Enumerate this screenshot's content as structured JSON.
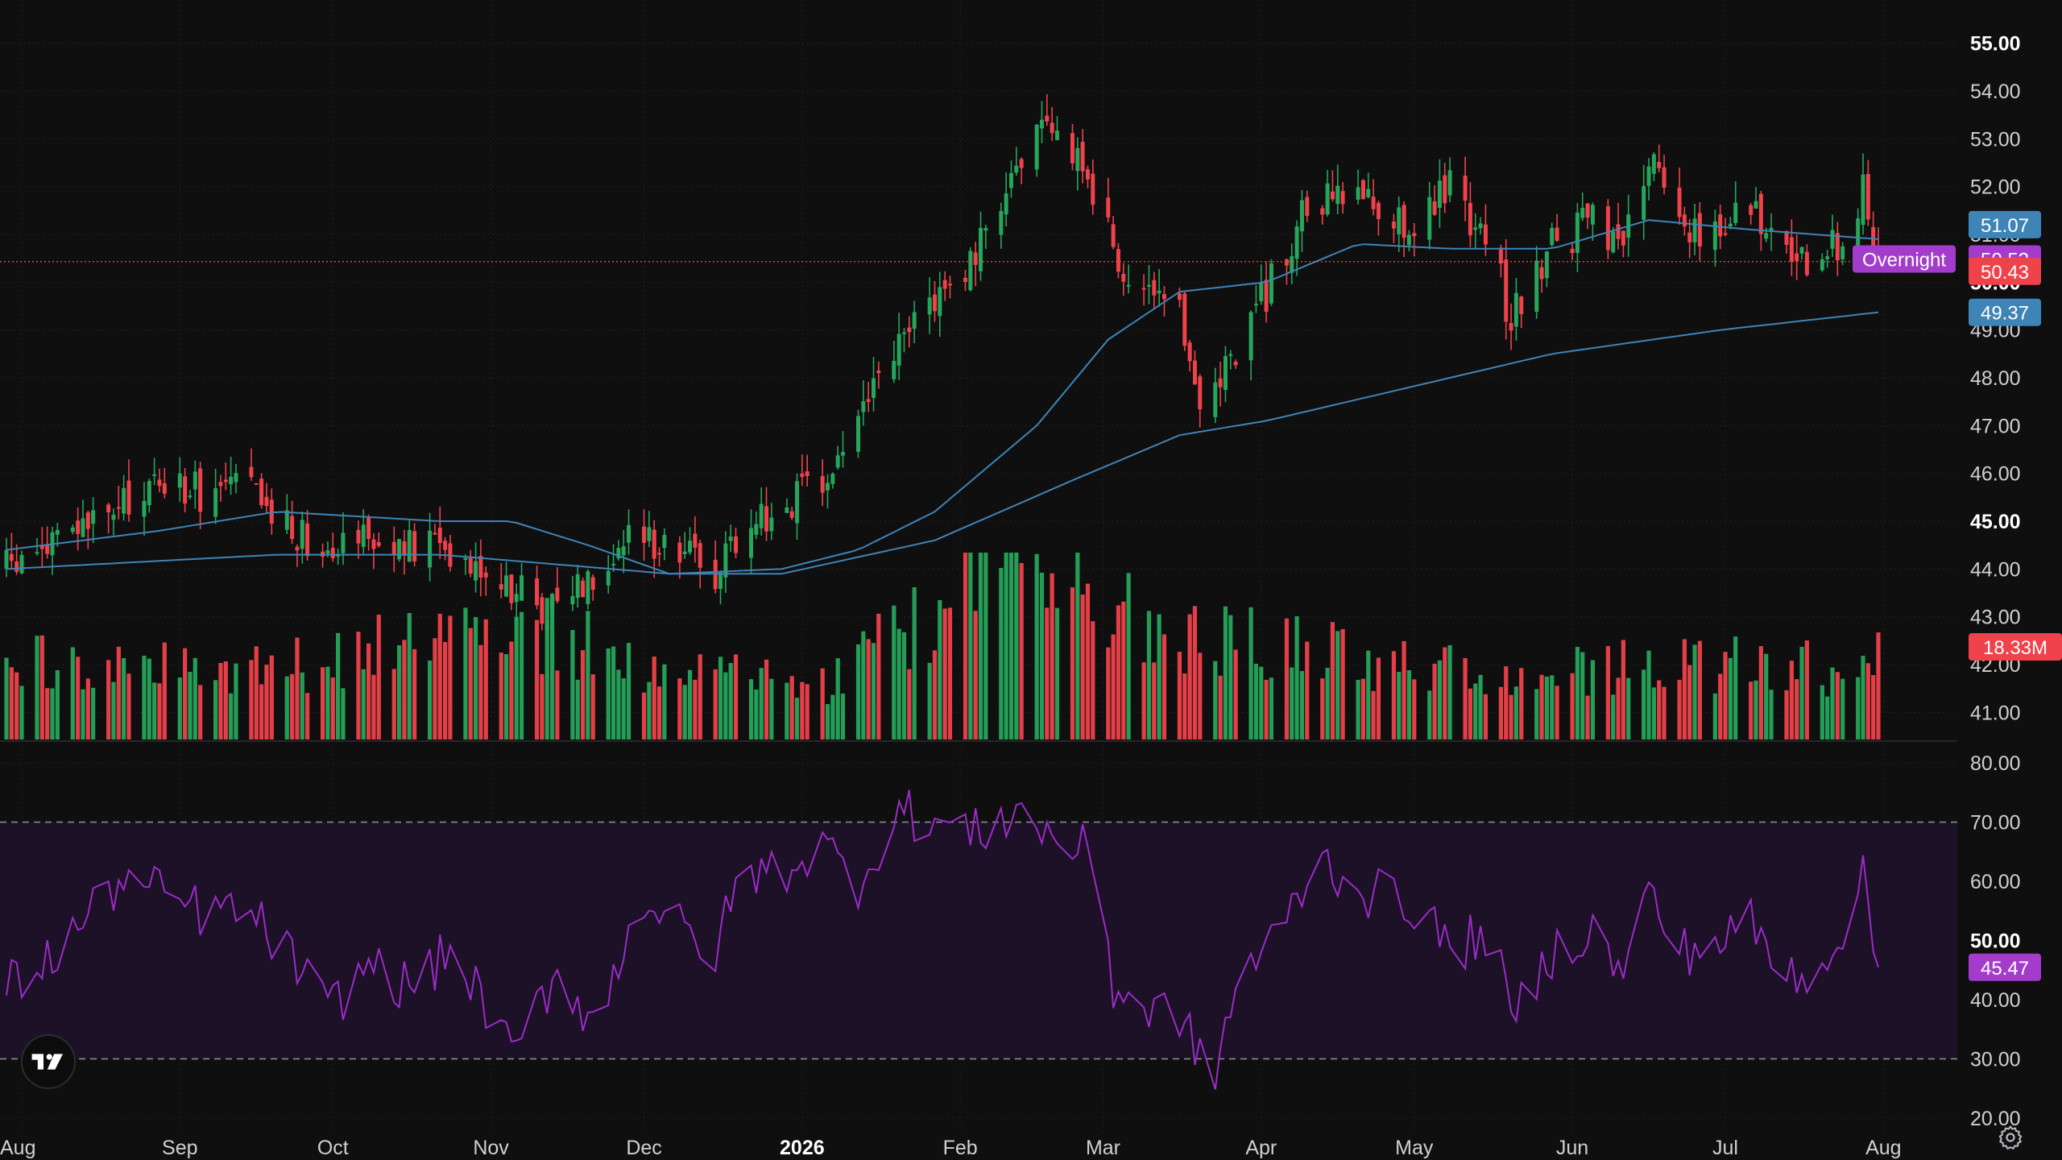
{
  "colors": {
    "background": "#0f0f10",
    "grid": "#1f1f22",
    "up": "#26a65b",
    "down": "#f0424b",
    "ma50": "#3f84b6",
    "ma200": "#3f84b6",
    "rsi_line": "#9c2bc7",
    "rsi_band": "#1c1127",
    "axis_text": "#d0d0d3",
    "axis_text_bold": "#ffffff",
    "overnight": "#a33ccb",
    "ma_label": "#3f84b6",
    "price_label": "#f0424b",
    "rsi_label": "#a33ccb"
  },
  "chart_data": [
    {
      "type": "candlestick",
      "title": "",
      "xlabel": "",
      "ylabel": "",
      "period": "2025-07-29 to 2026-07-31",
      "x_tick_labels": [
        "Aug",
        "Sep",
        "Oct",
        "Nov",
        "Dec",
        "2026",
        "Feb",
        "Mar",
        "Apr",
        "May",
        "Jun",
        "Jul",
        "Aug"
      ],
      "y_tick_labels": [
        "41.00",
        "42.00",
        "43.00",
        "44.00",
        "45.00",
        "46.00",
        "47.00",
        "48.00",
        "49.00",
        "50.00",
        "51.00",
        "52.00",
        "53.00",
        "54.00",
        "55.00"
      ],
      "bold_ticks": [
        "45.00",
        "50.00",
        "55.00"
      ],
      "ylim": [
        40.4,
        55.6
      ],
      "grid": true,
      "price_anchors": [
        [
          "2025-07-29",
          44.0
        ],
        [
          "2025-08-08",
          44.6
        ],
        [
          "2025-08-20",
          45.2
        ],
        [
          "2025-08-28",
          45.9
        ],
        [
          "2025-09-04",
          45.6
        ],
        [
          "2025-09-12",
          45.8
        ],
        [
          "2025-09-20",
          45.1
        ],
        [
          "2025-09-28",
          44.5
        ],
        [
          "2025-10-06",
          44.9
        ],
        [
          "2025-10-14",
          44.3
        ],
        [
          "2025-10-22",
          44.6
        ],
        [
          "2025-10-30",
          44.1
        ],
        [
          "2025-11-05",
          43.6
        ],
        [
          "2025-11-12",
          43.2
        ],
        [
          "2025-11-20",
          43.9
        ],
        [
          "2025-11-28",
          44.6
        ],
        [
          "2025-12-06",
          44.7
        ],
        [
          "2025-12-14",
          43.8
        ],
        [
          "2025-12-20",
          44.9
        ],
        [
          "2025-12-28",
          45.3
        ],
        [
          "2026-01-05",
          45.7
        ],
        [
          "2026-01-12",
          47.2
        ],
        [
          "2026-01-20",
          48.6
        ],
        [
          "2026-01-27",
          49.8
        ],
        [
          "2026-02-04",
          50.4
        ],
        [
          "2026-02-10",
          52.2
        ],
        [
          "2026-02-16",
          53.0
        ],
        [
          "2026-02-24",
          52.8
        ],
        [
          "2026-03-02",
          51.0
        ],
        [
          "2026-03-08",
          49.6
        ],
        [
          "2026-03-16",
          49.2
        ],
        [
          "2026-03-21",
          47.3
        ],
        [
          "2026-03-26",
          48.5
        ],
        [
          "2026-04-02",
          49.8
        ],
        [
          "2026-04-10",
          51.5
        ],
        [
          "2026-04-20",
          51.9
        ],
        [
          "2026-04-30",
          51.2
        ],
        [
          "2026-05-08",
          52.0
        ],
        [
          "2026-05-16",
          50.8
        ],
        [
          "2026-05-20",
          49.2
        ],
        [
          "2026-05-28",
          50.8
        ],
        [
          "2026-06-05",
          51.3
        ],
        [
          "2026-06-10",
          50.5
        ],
        [
          "2026-06-16",
          52.6
        ],
        [
          "2026-06-22",
          51.3
        ],
        [
          "2026-06-30",
          51.0
        ],
        [
          "2026-07-06",
          51.8
        ],
        [
          "2026-07-12",
          50.5
        ],
        [
          "2026-07-20",
          50.4
        ],
        [
          "2026-07-26",
          51.2
        ],
        [
          "2026-07-28",
          52.3
        ],
        [
          "2026-07-31",
          50.43
        ]
      ],
      "ma_50_anchors": [
        [
          "2025-07-29",
          44.4
        ],
        [
          "2025-08-28",
          44.8
        ],
        [
          "2025-09-20",
          45.2
        ],
        [
          "2025-10-22",
          45.0
        ],
        [
          "2025-11-05",
          45.0
        ],
        [
          "2025-11-20",
          44.5
        ],
        [
          "2025-12-06",
          43.9
        ],
        [
          "2025-12-28",
          44.0
        ],
        [
          "2026-01-12",
          44.4
        ],
        [
          "2026-01-27",
          45.2
        ],
        [
          "2026-02-16",
          47.0
        ],
        [
          "2026-03-02",
          48.8
        ],
        [
          "2026-03-16",
          49.8
        ],
        [
          "2026-04-02",
          50.0
        ],
        [
          "2026-04-20",
          50.8
        ],
        [
          "2026-05-08",
          50.7
        ],
        [
          "2026-05-28",
          50.7
        ],
        [
          "2026-06-16",
          51.3
        ],
        [
          "2026-07-06",
          51.1
        ],
        [
          "2026-07-31",
          50.9
        ]
      ],
      "ma_200_anchors": [
        [
          "2025-07-29",
          44.0
        ],
        [
          "2025-09-20",
          44.3
        ],
        [
          "2025-10-22",
          44.3
        ],
        [
          "2025-12-06",
          43.9
        ],
        [
          "2025-12-28",
          43.9
        ],
        [
          "2026-01-27",
          44.6
        ],
        [
          "2026-02-24",
          45.9
        ],
        [
          "2026-03-16",
          46.8
        ],
        [
          "2026-04-02",
          47.1
        ],
        [
          "2026-04-30",
          47.8
        ],
        [
          "2026-05-28",
          48.5
        ],
        [
          "2026-06-30",
          49.0
        ],
        [
          "2026-07-31",
          49.37
        ]
      ],
      "volume_anchors": [
        [
          "2025-08-10",
          13
        ],
        [
          "2025-09-20",
          12
        ],
        [
          "2025-11-05",
          20
        ],
        [
          "2025-12-06",
          12
        ],
        [
          "2026-01-05",
          9
        ],
        [
          "2026-02-10",
          30
        ],
        [
          "2026-03-08",
          20
        ],
        [
          "2026-04-20",
          14
        ],
        [
          "2026-05-20",
          11
        ],
        [
          "2026-06-16",
          13
        ],
        [
          "2026-07-31",
          12
        ]
      ],
      "volume_last": "18.33M",
      "moving_average_labels": [
        "51.07",
        "49.37"
      ],
      "last_price_label": "50.43",
      "overnight_label": "Overnight",
      "overnight_price": "50.52"
    },
    {
      "type": "line",
      "title": "",
      "xlabel": "",
      "ylabel": "",
      "y_tick_labels": [
        "20.00",
        "30.00",
        "40.00",
        "50.00",
        "60.00",
        "70.00",
        "80.00"
      ],
      "bold_ticks": [
        "50.00"
      ],
      "ylim": [
        17,
        83
      ],
      "overbought": 70,
      "oversold": 30,
      "rsi_anchors": [
        [
          "2025-07-29",
          42
        ],
        [
          "2025-08-08",
          48
        ],
        [
          "2025-08-20",
          60
        ],
        [
          "2025-08-28",
          58
        ],
        [
          "2025-09-05",
          55
        ],
        [
          "2025-09-14",
          55
        ],
        [
          "2025-09-22",
          48
        ],
        [
          "2025-09-30",
          38
        ],
        [
          "2025-10-08",
          46
        ],
        [
          "2025-10-16",
          42
        ],
        [
          "2025-10-24",
          48
        ],
        [
          "2025-11-01",
          38
        ],
        [
          "2025-11-05",
          30
        ],
        [
          "2025-11-14",
          45
        ],
        [
          "2025-11-22",
          35
        ],
        [
          "2025-11-30",
          58
        ],
        [
          "2025-12-08",
          52
        ],
        [
          "2025-12-14",
          46
        ],
        [
          "2025-12-20",
          61
        ],
        [
          "2025-12-28",
          62
        ],
        [
          "2026-01-05",
          66
        ],
        [
          "2026-01-12",
          60
        ],
        [
          "2026-01-20",
          72
        ],
        [
          "2026-01-27",
          70
        ],
        [
          "2026-02-04",
          68
        ],
        [
          "2026-02-12",
          72
        ],
        [
          "2026-02-20",
          67
        ],
        [
          "2026-02-28",
          64
        ],
        [
          "2026-03-03",
          42
        ],
        [
          "2026-03-10",
          38
        ],
        [
          "2026-03-16",
          38
        ],
        [
          "2026-03-22",
          25
        ],
        [
          "2026-03-28",
          45
        ],
        [
          "2026-04-04",
          50
        ],
        [
          "2026-04-12",
          64
        ],
        [
          "2026-04-22",
          58
        ],
        [
          "2026-05-02",
          56
        ],
        [
          "2026-05-08",
          48
        ],
        [
          "2026-05-16",
          52
        ],
        [
          "2026-05-20",
          36
        ],
        [
          "2026-05-28",
          48
        ],
        [
          "2026-06-05",
          52
        ],
        [
          "2026-06-10",
          44
        ],
        [
          "2026-06-16",
          58
        ],
        [
          "2026-06-22",
          48
        ],
        [
          "2026-06-30",
          50
        ],
        [
          "2026-07-06",
          53
        ],
        [
          "2026-07-12",
          44
        ],
        [
          "2026-07-20",
          46
        ],
        [
          "2026-07-26",
          56
        ],
        [
          "2026-07-28",
          60
        ],
        [
          "2026-07-31",
          45.47
        ]
      ],
      "last_value_label": "45.47"
    }
  ],
  "watermark": {
    "icon": "tradingview-logo-icon",
    "settings_icon": "gear-icon"
  }
}
